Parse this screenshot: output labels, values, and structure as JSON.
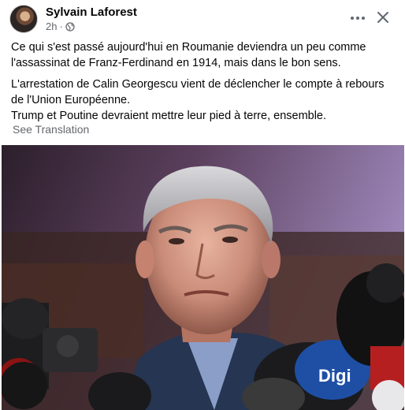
{
  "post": {
    "author": "Sylvain Laforest",
    "time": "2h",
    "separator": "·",
    "privacy_icon": "globe-icon",
    "more_icon": "more-horizontal-icon",
    "close_icon": "close-icon",
    "paragraphs": [
      "Ce qui s'est passé aujourd'hui en Roumanie deviendra un peu comme l'assassinat de Franz-Ferdinand en 1914, mais dans le bon sens.",
      "L'arrestation de Calin Georgescu vient de déclencher le compte à rebours de l'Union Européenne.",
      "Trump et Poutine devraient mettre leur pied à terre, ensemble."
    ],
    "see_translation": "See Translation",
    "photo_mic_label": "Digi"
  }
}
